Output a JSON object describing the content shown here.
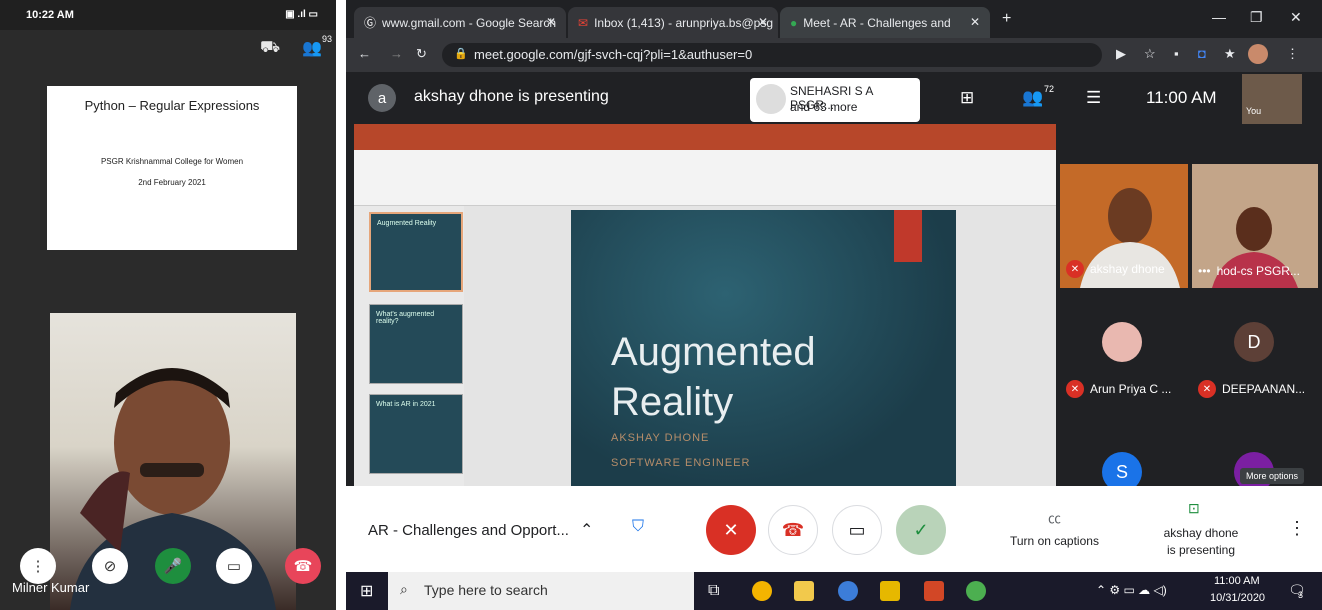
{
  "phone": {
    "time": "10:22 AM",
    "participants_count": "93",
    "slide": {
      "title": "Python – Regular Expressions",
      "org": "PSGR Krishnammal College for Women",
      "date": "2nd February 2021"
    },
    "participant_name": "Milner Kumar"
  },
  "browser": {
    "tabs": [
      {
        "label": "www.gmail.com - Google Search",
        "icon": "google-icon"
      },
      {
        "label": "Inbox (1,413) - arunpriya.bs@psg",
        "icon": "gmail-icon"
      },
      {
        "label": "Meet - AR - Challenges and",
        "icon": "meet-icon"
      }
    ],
    "url": "meet.google.com/gjf-svch-cqj?pli=1&authuser=0"
  },
  "meet": {
    "presenter_initial": "a",
    "presenting_text": "akshay dhone is presenting",
    "notification": {
      "line1": "SNEHASRI S A PSGR...",
      "line2": "and 63 more"
    },
    "participants_count": "72",
    "time": "11:00 AM",
    "self_label": "You",
    "slide": {
      "title1": "Augmented",
      "title2": "Reality",
      "sub1": "AKSHAY DHONE",
      "sub2": "SOFTWARE ENGINEER"
    },
    "thumb_titles": [
      "Augmented Reality",
      "What's augmented reality?",
      "What is AR in 2021"
    ],
    "tiles": [
      {
        "name": "akshay dhone"
      },
      {
        "name": "hod-cs PSGR..."
      },
      {
        "name": "Arun Priya C ..."
      },
      {
        "name": "DEEPAANAN...",
        "initial": "D"
      },
      {
        "initial": "S"
      }
    ],
    "more_options": "More options",
    "meeting_name": "AR - Challenges and Opport...",
    "captions": "Turn on captions",
    "present_line1": "akshay dhone",
    "present_line2": "is presenting"
  },
  "taskbar": {
    "search_placeholder": "Type here to search",
    "time": "11:00 AM",
    "date": "10/31/2020",
    "notif_count": "3"
  }
}
